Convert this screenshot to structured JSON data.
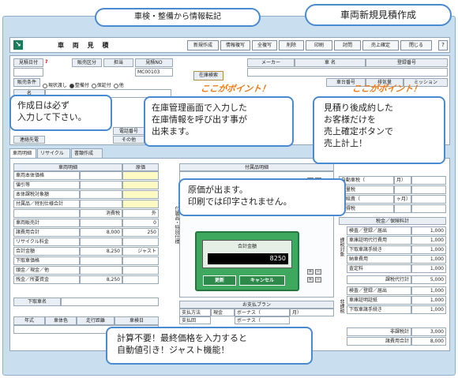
{
  "callouts": {
    "top_transfer": "車検・整備から情報転記",
    "top_title": "車両新規見積作成",
    "date_note": "作成日は必ず\n入力して下さい。",
    "stock_note": "在庫管理画面で入力した\n在庫情報を呼び出す事が\n出来ます。",
    "confirm_note": "見積り後成約した\nお客様だけを\n売上確定ボタンで\n売上計上！",
    "cost_note": "原価が出ます。\n印刷では印字されません。",
    "just_note": "計算不要！最終価格を入力すると\n自動値引き！ジャスト機能！",
    "point1": "ここがポイント！",
    "point2": "ここがポイント！"
  },
  "toolbar": {
    "title": "車 両 見 積",
    "buttons": [
      "新規作成",
      "情報複写",
      "全複写",
      "削除",
      "印刷",
      "討問",
      "売上確定",
      "閉じる"
    ],
    "help": "?"
  },
  "header": {
    "date_label": "見積日付",
    "date_marker": "?",
    "sales_type_label": "販売区分",
    "staff_label": "担当",
    "estimate_no_label": "見積NO",
    "estimate_no": "MC00103",
    "maker_label": "メーカー",
    "car_name_label": "車 名",
    "reg_no_label": "登録番号",
    "stock_search": "在庫検索",
    "car_no_label": "車台番号",
    "displacement_label": "排気量",
    "mission_label": "ミッション",
    "sale_type_label": "販売条件",
    "sale_options": [
      "現状渡し",
      "整備付",
      "保証付",
      "他"
    ],
    "name_label": "名",
    "phone_label": "電話番号",
    "contact_label": "連絡先電",
    "other_label": "その他"
  },
  "tabs": [
    "車両明細",
    "リサイクル",
    "書類作成"
  ],
  "left_table": {
    "col1": "車両明細",
    "col2": "原価",
    "rows": [
      {
        "label": "車両本体価格",
        "value": "",
        "cost": ""
      },
      {
        "label": "値引等",
        "value": "",
        "cost": ""
      },
      {
        "label": "本体課税対象額",
        "value": "",
        "cost": ""
      },
      {
        "label": "付属品／特別仕様合計",
        "value": "",
        "cost": ""
      },
      {
        "label": "",
        "value": "消費税",
        "cost": "外"
      },
      {
        "label": "車両販売計",
        "value": "",
        "cost": "0"
      },
      {
        "label": "諸費用合計",
        "value": "8,000",
        "cost": "250"
      },
      {
        "label": "リサイクル料金",
        "value": "",
        "cost": ""
      },
      {
        "label": "合計金額",
        "value": "8,250",
        "cost": "ジャスト"
      },
      {
        "label": "下取車価格",
        "value": "",
        "cost": ""
      },
      {
        "label": "頭金／現金／他",
        "value": "",
        "cost": ""
      },
      {
        "label": "残金／所要資金",
        "value": "8,250",
        "cost": ""
      }
    ],
    "trade_label": "下取車名",
    "trade_cols": [
      "年式",
      "車体色",
      "走行距離",
      "車検日"
    ]
  },
  "middle": {
    "header": "付属品明細",
    "side_label": "付属品・特別仕様",
    "plan_header": "お支払プラン",
    "pay_method": "支払方法",
    "cash": "現金",
    "bonus1": "ボーナス（",
    "bonus2": "ボーナス（",
    "month": "月）",
    "pay_other": "支払回"
  },
  "right_table": {
    "top_rows": [
      {
        "label": "自動車税（",
        "suffix": "月）",
        "value": ""
      },
      {
        "label": "重量税",
        "suffix": "",
        "value": ""
      },
      {
        "label": "自賠責（",
        "suffix": "ヶ月）",
        "value": ""
      },
      {
        "label": "取得税",
        "suffix": "",
        "value": ""
      }
    ],
    "tax_header": "税金／保険料計",
    "section1_label": "課税対象",
    "section1": [
      {
        "label": "検査／登録／届出",
        "value": "1,000"
      },
      {
        "label": "車庫証明代行費用",
        "value": "1,000"
      },
      {
        "label": "下取車諸手続き",
        "value": "1,000"
      },
      {
        "label": "納車費用",
        "value": "1,000"
      },
      {
        "label": "査定料",
        "value": "1,000"
      }
    ],
    "taxable_total_label": "課税代行計",
    "taxable_total": "5,000",
    "section2_label": "非課税",
    "section2": [
      {
        "label": "検査／登録／届出",
        "value": "1,000"
      },
      {
        "label": "車庫証明証紙",
        "value": "1,000"
      },
      {
        "label": "下取車諸手続き",
        "value": "1,000"
      }
    ],
    "nontax_total_label": "非課税計",
    "nontax_total": "3,000",
    "grand_label": "諸費用合計",
    "grand_total": "8,000"
  },
  "dialog": {
    "title": "合計金額",
    "value": "8250",
    "update": "更新",
    "cancel": "キャンセル"
  }
}
